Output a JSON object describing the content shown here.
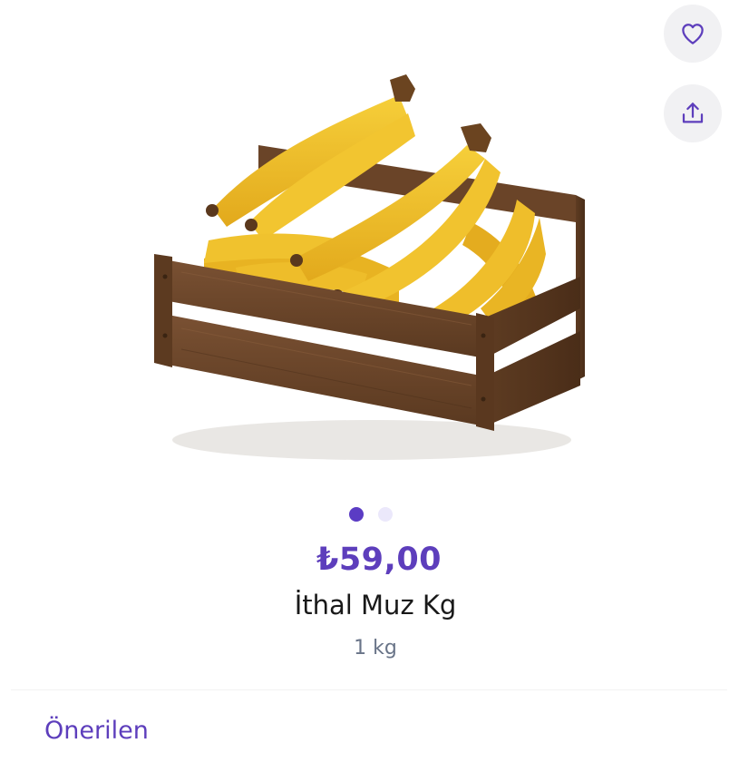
{
  "product": {
    "image_name": "banana-crate-image",
    "price": "₺59,00",
    "name": "İthal Muz Kg",
    "unit": "1 kg"
  },
  "actions": {
    "favorite_icon": "heart-icon",
    "share_icon": "share-icon"
  },
  "carousel": {
    "total": 2,
    "active_index": 0
  },
  "recommendations": {
    "title": "Önerilen"
  },
  "colors": {
    "accent": "#5d3ebc",
    "dot_active": "#5b3cc4",
    "dot_inactive": "#ebe8fb",
    "button_bg": "#f1f1f3",
    "text_primary": "#191919",
    "text_secondary": "#697488"
  }
}
